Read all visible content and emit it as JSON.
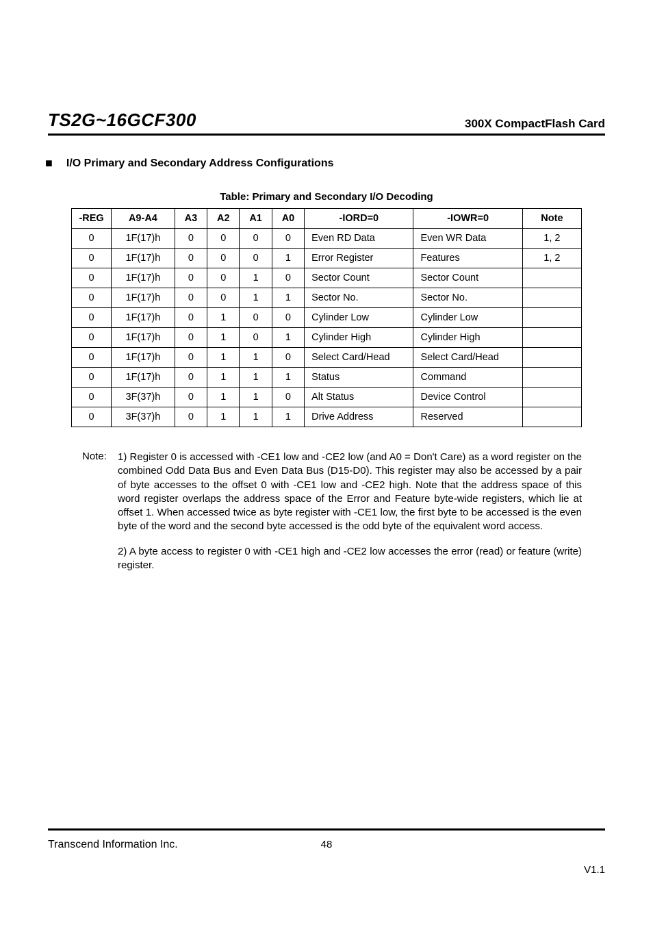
{
  "header": {
    "model": "TS2G~16GCF300",
    "product": "300X CompactFlash Card"
  },
  "section": {
    "title": "I/O Primary and Secondary Address Configurations"
  },
  "table": {
    "caption": "Table: Primary and Secondary I/O Decoding",
    "headers": {
      "reg": "-REG",
      "a9a4": "A9-A4",
      "a3": "A3",
      "a2": "A2",
      "a1": "A1",
      "a0": "A0",
      "iord": "-IORD=0",
      "iowr": "-IOWR=0",
      "note": "Note"
    },
    "rows": [
      {
        "reg": "0",
        "a9a4": "1F(17)h",
        "a3": "0",
        "a2": "0",
        "a1": "0",
        "a0": "0",
        "iord": "Even RD Data",
        "iowr": "Even WR Data",
        "note": "1, 2"
      },
      {
        "reg": "0",
        "a9a4": "1F(17)h",
        "a3": "0",
        "a2": "0",
        "a1": "0",
        "a0": "1",
        "iord": "Error Register",
        "iowr": "Features",
        "note": "1, 2"
      },
      {
        "reg": "0",
        "a9a4": "1F(17)h",
        "a3": "0",
        "a2": "0",
        "a1": "1",
        "a0": "0",
        "iord": "Sector Count",
        "iowr": "Sector Count",
        "note": ""
      },
      {
        "reg": "0",
        "a9a4": "1F(17)h",
        "a3": "0",
        "a2": "0",
        "a1": "1",
        "a0": "1",
        "iord": "Sector No.",
        "iowr": "Sector No.",
        "note": ""
      },
      {
        "reg": "0",
        "a9a4": "1F(17)h",
        "a3": "0",
        "a2": "1",
        "a1": "0",
        "a0": "0",
        "iord": "Cylinder Low",
        "iowr": "Cylinder Low",
        "note": ""
      },
      {
        "reg": "0",
        "a9a4": "1F(17)h",
        "a3": "0",
        "a2": "1",
        "a1": "0",
        "a0": "1",
        "iord": "Cylinder High",
        "iowr": "Cylinder High",
        "note": ""
      },
      {
        "reg": "0",
        "a9a4": "1F(17)h",
        "a3": "0",
        "a2": "1",
        "a1": "1",
        "a0": "0",
        "iord": "Select Card/Head",
        "iowr": "Select Card/Head",
        "note": ""
      },
      {
        "reg": "0",
        "a9a4": "1F(17)h",
        "a3": "0",
        "a2": "1",
        "a1": "1",
        "a0": "1",
        "iord": "Status",
        "iowr": "Command",
        "note": ""
      },
      {
        "reg": "0",
        "a9a4": "3F(37)h",
        "a3": "0",
        "a2": "1",
        "a1": "1",
        "a0": "0",
        "iord": "Alt Status",
        "iowr": "Device Control",
        "note": ""
      },
      {
        "reg": "0",
        "a9a4": "3F(37)h",
        "a3": "0",
        "a2": "1",
        "a1": "1",
        "a0": "1",
        "iord": "Drive Address",
        "iowr": "Reserved",
        "note": ""
      }
    ]
  },
  "notes": {
    "label": "Note:",
    "n1": "1) Register 0 is accessed with -CE1 low and -CE2 low (and A0 = Don't Care) as a word register on the combined Odd Data Bus and Even Data Bus (D15-D0). This register may also be accessed by a pair of byte accesses to the offset 0 with -CE1 low and -CE2 high. Note that the address space of this word register overlaps the address space of the Error and Feature byte-wide registers, which lie at offset 1. When accessed twice as byte register with -CE1 low, the first byte to be accessed is the even byte of the word and the second byte accessed is the odd byte of the equivalent word access.",
    "n2": "2) A byte access to register 0 with -CE1 high and -CE2 low accesses the error (read) or feature (write) register."
  },
  "footer": {
    "company": "Transcend Information Inc.",
    "page": "48",
    "version": "V1.1"
  }
}
